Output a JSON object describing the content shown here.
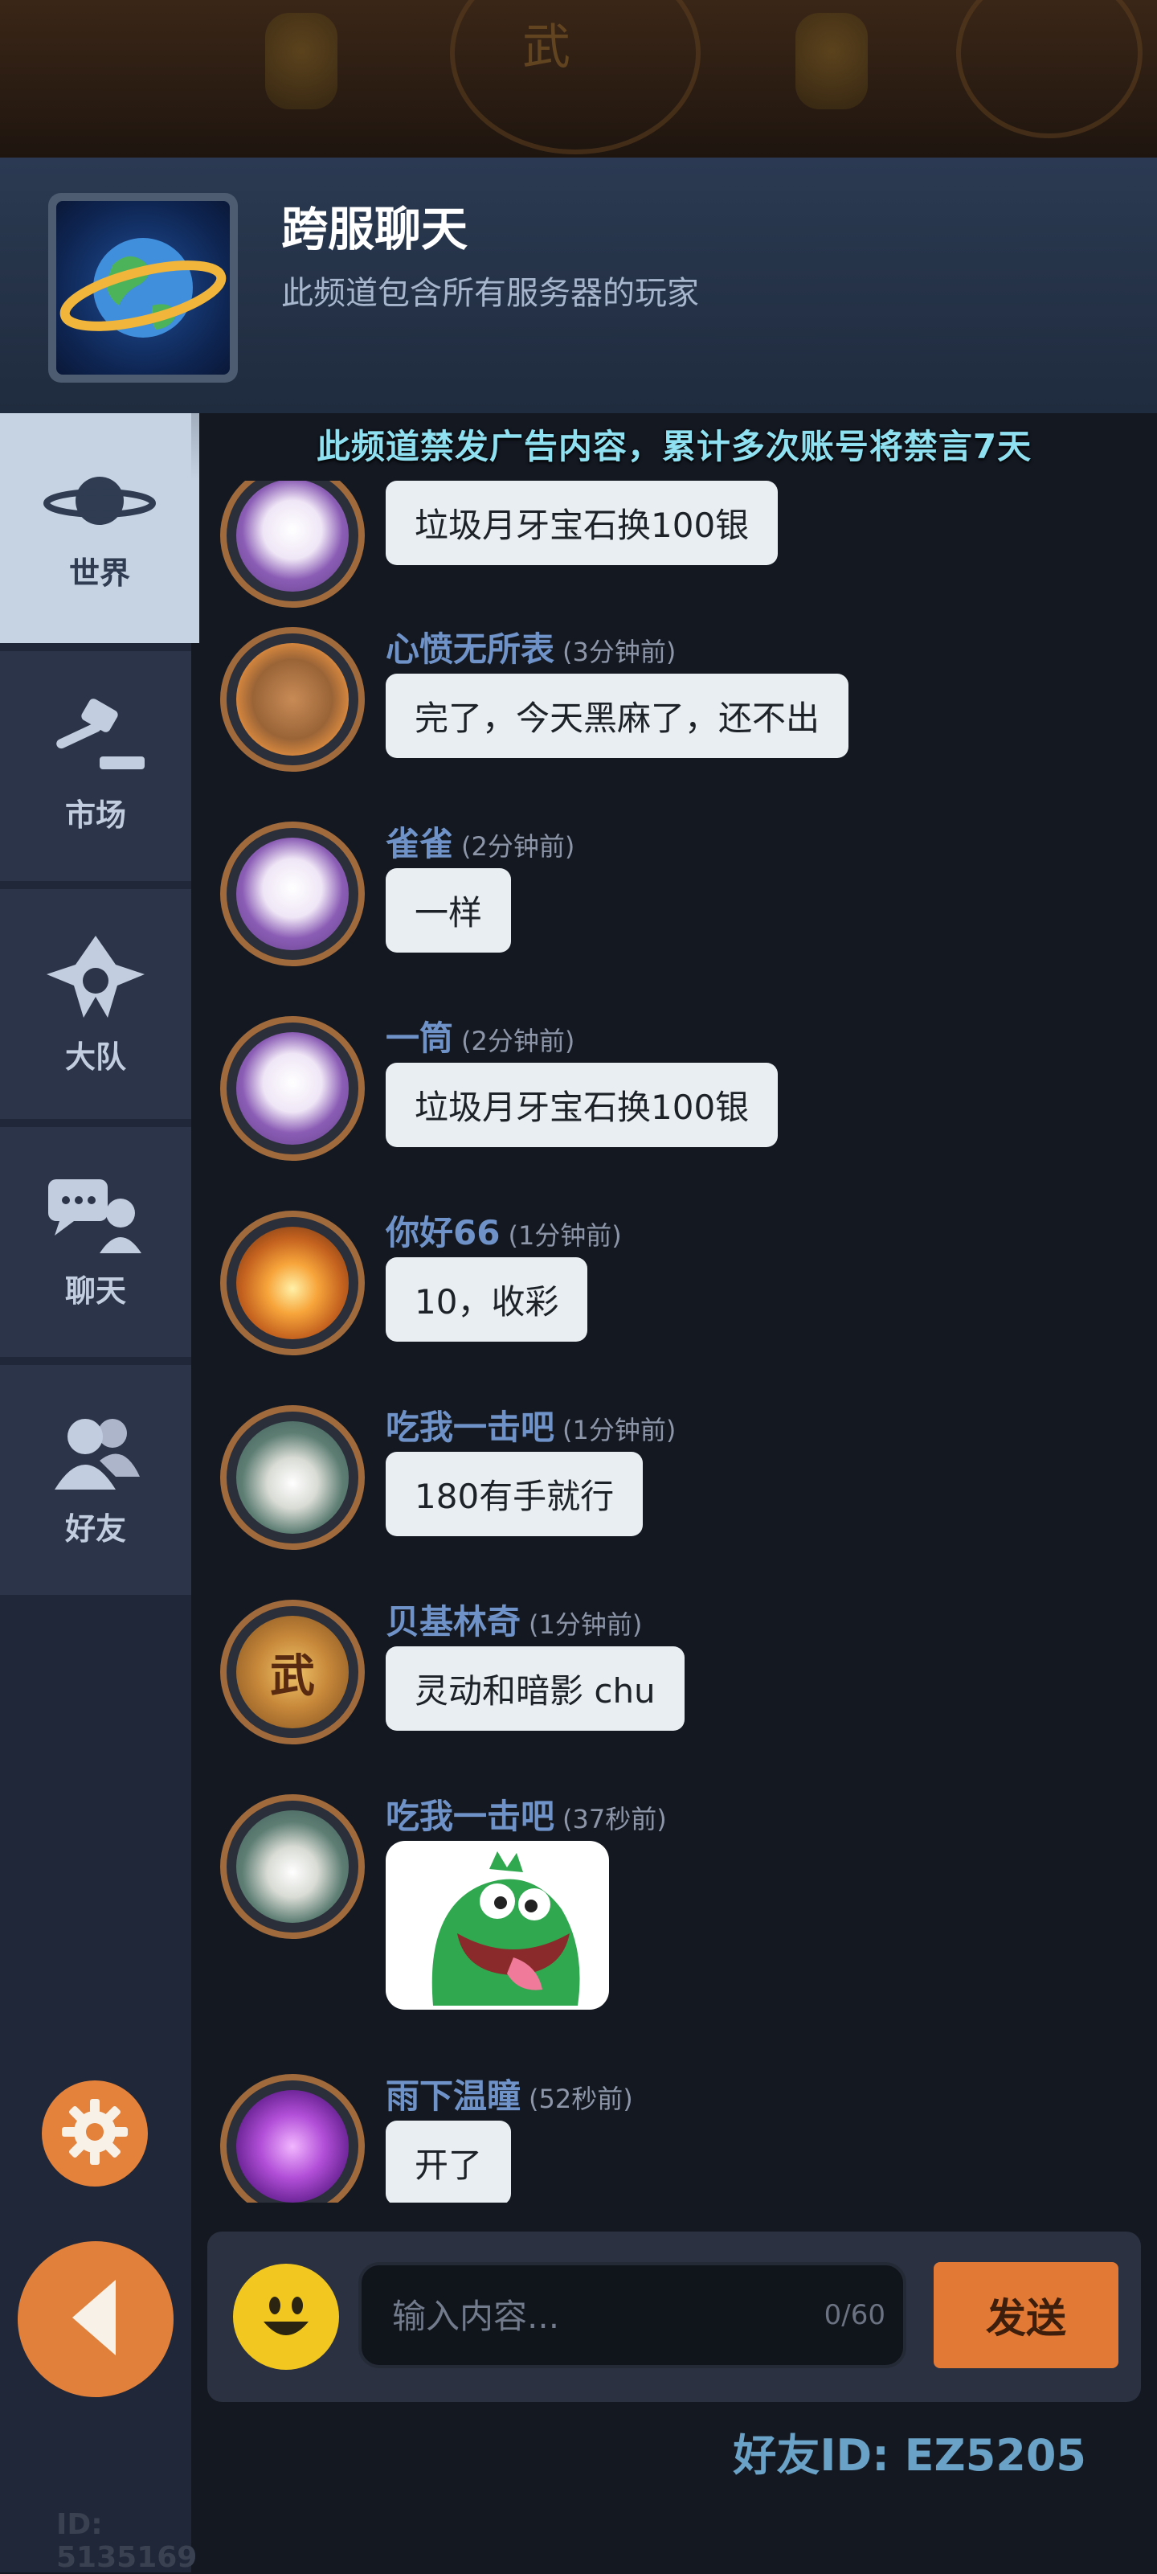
{
  "header": {
    "title": "跨服聊天",
    "subtitle": "此频道包含所有服务器的玩家"
  },
  "notice": "此频道禁发广告内容，累计多次账号将禁言7天",
  "sidebar": {
    "items": [
      {
        "label": "世界",
        "icon": "planet-icon",
        "active": true
      },
      {
        "label": "市场",
        "icon": "gavel-icon",
        "active": false
      },
      {
        "label": "大队",
        "icon": "guild-emblem-icon",
        "active": false
      },
      {
        "label": "聊天",
        "icon": "chat-person-icon",
        "active": false
      },
      {
        "label": "好友",
        "icon": "friends-icon",
        "active": false
      }
    ],
    "user_id": "ID: 5135169"
  },
  "messages": [
    {
      "name": "",
      "time": "",
      "text": "垃圾月牙宝石换100银",
      "avatar": "sheep"
    },
    {
      "name": "心愤无所表",
      "time": "(3分钟前)",
      "text": "完了，今天黑麻了，还不出",
      "avatar": "bear"
    },
    {
      "name": "雀雀",
      "time": "(2分钟前)",
      "text": "一样",
      "avatar": "sheep"
    },
    {
      "name": "一筒",
      "time": "(2分钟前)",
      "text": "垃圾月牙宝石换100银",
      "avatar": "sheep"
    },
    {
      "name": "你好66",
      "time": "(1分钟前)",
      "text": "10，收彩",
      "avatar": "fire"
    },
    {
      "name": "吃我一击吧",
      "time": "(1分钟前)",
      "text": "180有手就行",
      "avatar": "panda"
    },
    {
      "name": "贝基林奇",
      "time": "(1分钟前)",
      "text": "灵动和暗影 chu",
      "avatar": "wu"
    },
    {
      "name": "吃我一击吧",
      "time": "(37秒前)",
      "text": "",
      "avatar": "panda",
      "sticker": "green-dinosaur-sticker"
    },
    {
      "name": "雨下温瞳",
      "time": "(52秒前)",
      "text": "开了",
      "avatar": "book"
    }
  ],
  "input": {
    "placeholder": "输入内容...",
    "counter": "0/60",
    "send_label": "发送"
  },
  "friend_id": "好友ID: EZ5205",
  "colors": {
    "accent_orange": "#e27a36",
    "name_blue": "#6f93c8",
    "notice_cyan": "#8fe0f0",
    "emoji_yellow": "#f2c820"
  }
}
